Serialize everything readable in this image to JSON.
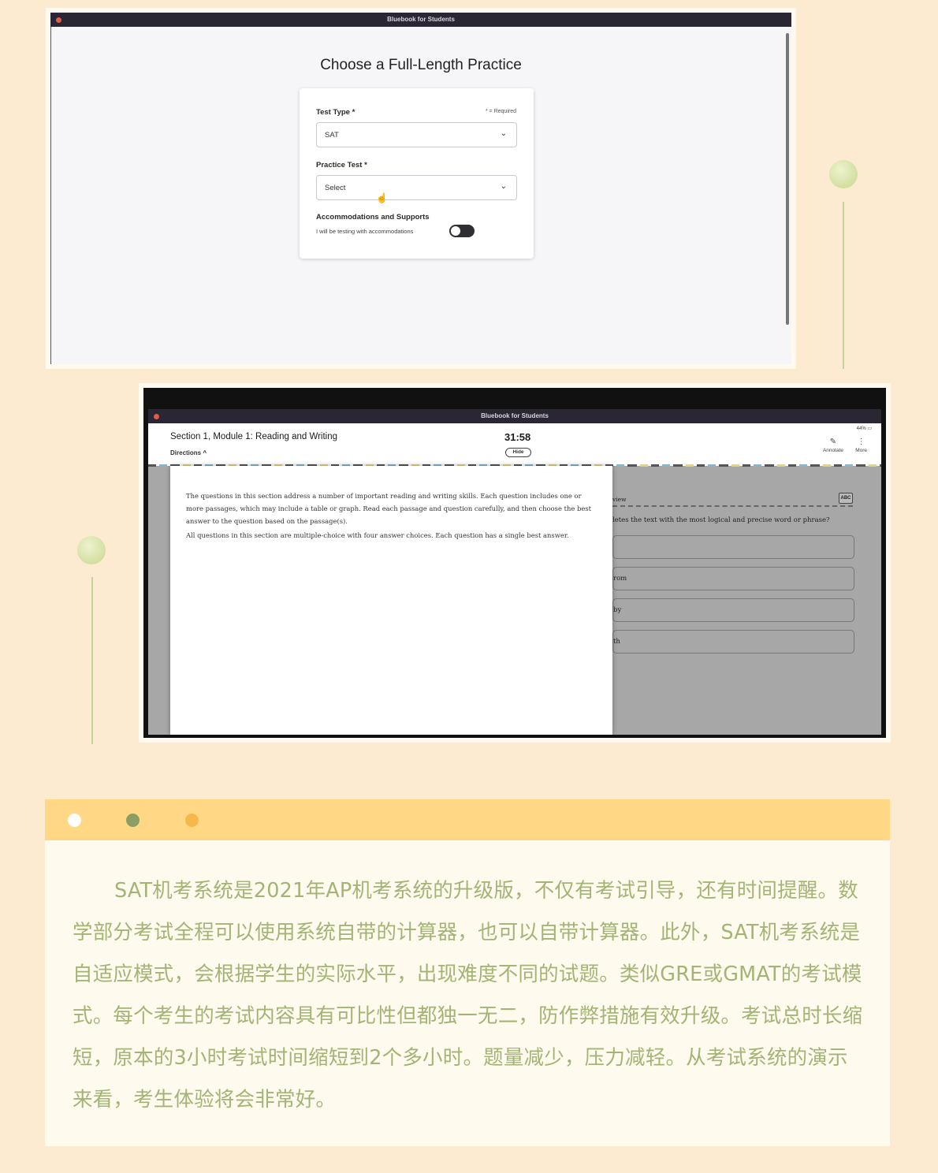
{
  "colors": {
    "background": "#fcebd0",
    "text_green": "#a3b476",
    "header_yellow": "#ffd785",
    "dot_white": "#ffffff",
    "dot_green": "#8a9e66",
    "dot_orange": "#f5b94b"
  },
  "screenshot1": {
    "window_title": "Bluebook for Students",
    "page_title": "Choose a Full-Length Practice",
    "required_note": "* = Required",
    "test_type_label": "Test Type *",
    "test_type_value": "SAT",
    "practice_test_label": "Practice Test *",
    "practice_test_value": "Select",
    "accommodations_label": "Accommodations and Supports",
    "accommodations_text": "I will be testing with accommodations",
    "accommodations_on": false,
    "icons": [
      "chevron-down-icon",
      "hand-cursor-icon"
    ]
  },
  "screenshot2": {
    "window_title": "Bluebook for Students",
    "section_title": "Section 1, Module 1: Reading and Writing",
    "directions_label": "Directions ^",
    "timer": "31:58",
    "hide_label": "Hide",
    "battery": "44%",
    "annotate_label": "Annotate",
    "more_label": "More",
    "directions_p1": "The questions in this section address a number of important reading and writing skills. Each question includes one or more passages, which may include a table or graph. Read each passage and question carefully, and then choose the best answer to the question based on the passage(s).",
    "directions_p2": "All questions in this section are multiple-choice with four answer choices. Each question has a single best answer.",
    "question_bar_text": "view",
    "abc_label": "ABC",
    "question_text": "letes the text with the most logical and precise word or phrase?",
    "choices": [
      "",
      "rom",
      " by",
      "th"
    ],
    "icons": [
      "pencil-icon",
      "more-vertical-icon",
      "battery-icon",
      "chevron-up-icon"
    ]
  },
  "info": {
    "paragraph": "SAT机考系统是2021年AP机考系统的升级版，不仅有考试引导，还有时间提醒。数学部分考试全程可以使用系统自带的计算器，也可以自带计算器。此外，SAT机考系统是自适应模式，会根据学生的实际水平，出现难度不同的试题。类似GRE或GMAT的考试模式。每个考生的考试内容具有可比性但都独一无二，防作弊措施有效升级。考试总时长缩短，原本的3小时考试时间缩短到2个多小时。题量减少，压力减轻。从考试系统的演示来看，考生体验将会非常好。"
  }
}
